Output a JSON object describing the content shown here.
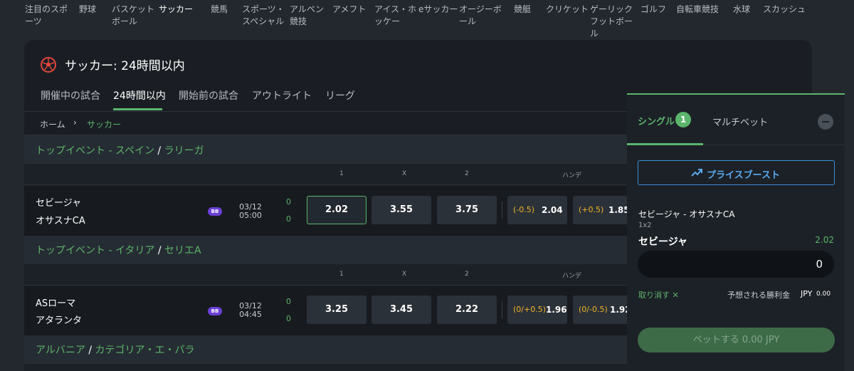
{
  "nav": {
    "items": [
      {
        "label": "注目のスポ\nーツ"
      },
      {
        "label": "野球"
      },
      {
        "label": "バスケット\nボール"
      },
      {
        "label": "サッカー",
        "active": true
      },
      {
        "label": "競馬"
      },
      {
        "label": "スポーツ・\nスペシャル"
      },
      {
        "label": "アルペン\n競技"
      },
      {
        "label": "アメフト"
      },
      {
        "label": "アイス・ホ\nッケー"
      },
      {
        "label": "eサッカー"
      },
      {
        "label": "オージーボ\nール"
      },
      {
        "label": "競艇"
      },
      {
        "label": "クリケット"
      },
      {
        "label": "ゲーリック\nフットボー\nル"
      },
      {
        "label": "ゴルフ"
      },
      {
        "label": "自転車競技"
      },
      {
        "label": "水球"
      },
      {
        "label": "スカッシュ"
      }
    ]
  },
  "header": {
    "title": "サッカー: 24時間以内",
    "icon": "soccer-ball-icon",
    "tabs": [
      "開催中の試合",
      "24時間以内",
      "開始前の試合",
      "アウトライト",
      "リーグ"
    ],
    "active_tab": "24時間以内"
  },
  "breadcrumb": {
    "home": "ホーム",
    "separator": "›",
    "current": "サッカー"
  },
  "columns": {
    "one": "1",
    "draw": "X",
    "two": "2",
    "handicap": "ハンデ"
  },
  "leagues": [
    {
      "prefix": "トップイベント - スペイン",
      "name": "ラリーガ",
      "match": {
        "home": "セビージャ",
        "away": "オサスナCA",
        "badge": "BB",
        "date": "03/12",
        "time": "05:00",
        "score_home": "0",
        "score_away": "0",
        "odds_1": "2.02",
        "odds_x": "3.55",
        "odds_2": "3.75",
        "hcap_home_line": "(-0.5)",
        "hcap_home_odds": "2.04",
        "hcap_away_line": "(+0.5)",
        "hcap_away_odds": "1.85"
      }
    },
    {
      "prefix": "トップイベント - イタリア",
      "name": "セリエA",
      "match": {
        "home": "ASローマ",
        "away": "アタランタ",
        "badge": "BB",
        "date": "03/12",
        "time": "04:45",
        "score_home": "0",
        "score_away": "0",
        "odds_1": "3.25",
        "odds_x": "3.45",
        "odds_2": "2.22",
        "hcap_home_line": "(0/+0.5)",
        "hcap_home_odds": "1.96",
        "hcap_away_line": "(0/-0.5)",
        "hcap_away_odds": "1.92"
      }
    },
    {
      "prefix": "アルバニア",
      "name": "カテゴリア・エ・パラ"
    }
  ],
  "betslip": {
    "tab_single": "シングル",
    "single_count": "1",
    "tab_multi": "マルチベット",
    "boost_label": "プライスブースト",
    "selection": {
      "event": "セビージャ - オサスナCA",
      "market": "1x2",
      "pick": "セビージャ",
      "odds": "2.02"
    },
    "stake_value": "0",
    "remove_label": "取り消す",
    "remove_icon": "✕",
    "estimated_label": "予想される勝利金",
    "estimated_currency": "JPY",
    "estimated_value": "0.00",
    "bet_label": "ベットする  0.00 JPY"
  },
  "colors": {
    "accent": "#5bb56a",
    "boost": "#3a8fd8",
    "handicap_line": "#f0b429",
    "badge": "#6a3fd6"
  }
}
